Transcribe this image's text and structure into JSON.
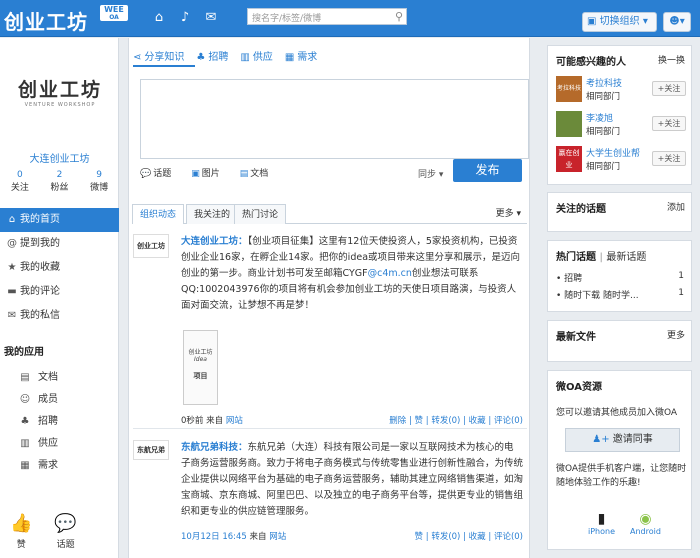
{
  "topbar": {
    "app_title": "创业工坊",
    "wee_label": "WEE",
    "wee_sub": "OA",
    "search_placeholder": "搜名字/标签/微博",
    "switch_org": "切换组织"
  },
  "profile": {
    "logo_text": "创业工坊",
    "logo_sub": "VENTURE WORKSHOP",
    "org_name": "大连创业工坊",
    "stats": [
      {
        "count": "0",
        "label": "关注"
      },
      {
        "count": "2",
        "label": "粉丝"
      },
      {
        "count": "9",
        "label": "微博"
      }
    ]
  },
  "nav": {
    "items": [
      {
        "label": "我的首页",
        "icon": "home-icon"
      },
      {
        "label": "提到我的",
        "icon": "at-icon"
      },
      {
        "label": "我的收藏",
        "icon": "star-icon"
      },
      {
        "label": "我的评论",
        "icon": "comment-icon"
      },
      {
        "label": "我的私信",
        "icon": "mail-icon"
      }
    ]
  },
  "apps": {
    "title": "我的应用",
    "items": [
      {
        "label": "文档",
        "icon": "document-icon"
      },
      {
        "label": "成员",
        "icon": "members-icon"
      },
      {
        "label": "招聘",
        "icon": "recruit-icon"
      },
      {
        "label": "供应",
        "icon": "supply-icon"
      },
      {
        "label": "需求",
        "icon": "demand-icon"
      }
    ],
    "bottom": [
      {
        "label": "赞",
        "icon": "thumbs-up-icon"
      },
      {
        "label": "话题",
        "icon": "topic-icon"
      }
    ]
  },
  "composer": {
    "tabs": [
      "分享知识",
      "招聘",
      "供应",
      "需求"
    ],
    "tools": [
      "话题",
      "图片",
      "文档"
    ],
    "sync_label": "同步",
    "publish_label": "发布"
  },
  "feed": {
    "tabs": [
      "组织动态",
      "我关注的",
      "热门讨论"
    ],
    "more": "更多",
    "posts": [
      {
        "author": "大连创业工坊：",
        "logo": "创业工坊",
        "text_before": "【创业项目征集】这里有12位天使投资人，5家投资机构，已投资创业企业16家，在孵企业14家。把你的idea或项目带来这里分享和展示，是迈向创业的第一步。商业计划书可发至邮箱CYGF",
        "email_link": "@c4m.cn",
        "text_after": "创业想法可联系QQ:1002043976你的项目将有机会参加创业工坊的天使日项目路演，与投资人面对面交流，让梦想不再是梦！",
        "image_top": "创业工坊",
        "image_mid": "Idea",
        "image_caption": "项目",
        "time": "0秒前",
        "source_prefix": "来自",
        "source": "网站",
        "actions": [
          "删除",
          "赞",
          "转发(0)",
          "收藏",
          "评论(0)"
        ]
      },
      {
        "author": "东航兄弟科技：",
        "logo": "东航兄弟",
        "text": "东航兄弟（大连）科技有限公司是一家以互联网技术为核心的电子商务运营服务商。致力于将电子商务模式与传统零售业进行创新性融合，为传统企业提供以网络平台为基础的电子商务运营服务，辅助其建立网络销售渠道，如淘宝商城、京东商城、阿里巴巴、以及独立的电子商务平台等，提供更专业的销售组织和更专业的供应链管理服务。",
        "time": "10月12日 16:45",
        "source_prefix": "来自",
        "source": "网站",
        "actions": [
          "赞",
          "转发(0)",
          "收藏",
          "评论(0)"
        ]
      }
    ]
  },
  "sidebar": {
    "suggest": {
      "title": "可能感兴趣的人",
      "refresh": "换一换",
      "people": [
        {
          "name": "考拉科技",
          "dept": "相同部门",
          "avatar_text": "考拉科技"
        },
        {
          "name": "李凌旭",
          "dept": "相同部门",
          "avatar_text": ""
        },
        {
          "name": "大学生创业帮",
          "dept": "相同部门",
          "avatar_text": "赢在创业"
        }
      ],
      "follow_label": "+关注"
    },
    "topics": {
      "title": "关注的话题",
      "add": "添加"
    },
    "hot": {
      "title": "热门话题",
      "sep": "|",
      "latest": "最新话题",
      "items": [
        {
          "name": "招聘",
          "count": "1"
        },
        {
          "name": "随时下载 随时学...",
          "count": "1"
        }
      ]
    },
    "files": {
      "title": "最新文件",
      "more": "更多"
    },
    "oa": {
      "title": "微OA资源",
      "invite_text": "您可以邀请其他成员加入微OA",
      "invite_button": "邀请同事",
      "client_text": "微OA提供手机客户端，让您随时随地体验工作的乐趣!",
      "platforms": [
        "iPhone",
        "Android"
      ]
    }
  },
  "colors": {
    "brand": "#2a7fd2",
    "background": "#e8ecf0"
  }
}
